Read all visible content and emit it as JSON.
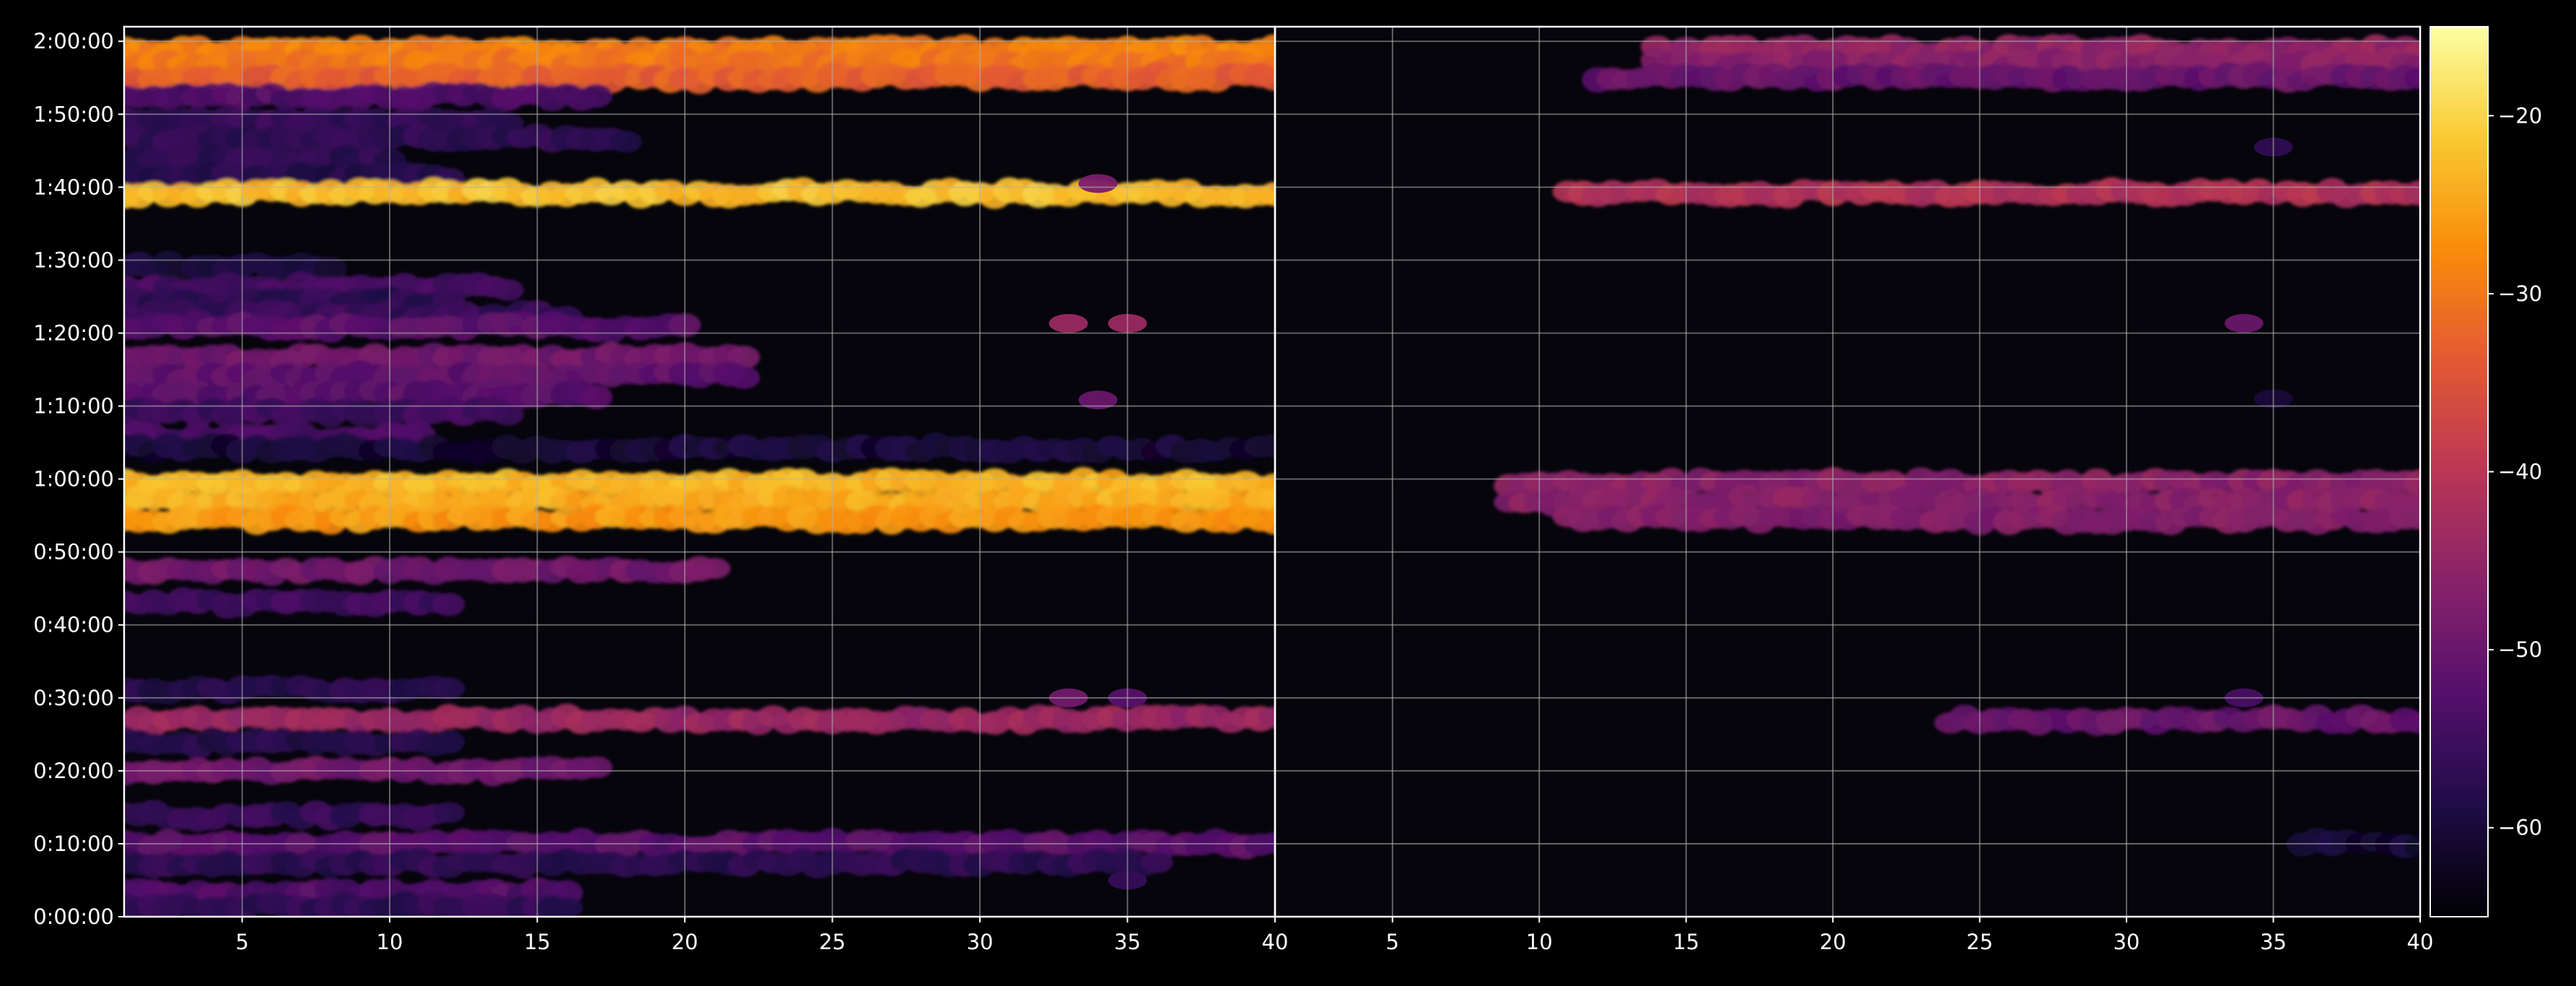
{
  "chart_data": {
    "type": "heatmap",
    "colormap": "inferno",
    "background": "#000000",
    "foreground": "#ffffff",
    "grid": true,
    "title": "",
    "xlabel": "",
    "ylabel": "",
    "y_range_seconds": [
      0,
      7320
    ],
    "y_ticks": [
      {
        "value": 0,
        "label": "0:00:00"
      },
      {
        "value": 600,
        "label": "0:10:00"
      },
      {
        "value": 1200,
        "label": "0:20:00"
      },
      {
        "value": 1800,
        "label": "0:30:00"
      },
      {
        "value": 2400,
        "label": "0:40:00"
      },
      {
        "value": 3000,
        "label": "0:50:00"
      },
      {
        "value": 3600,
        "label": "1:00:00"
      },
      {
        "value": 4200,
        "label": "1:10:00"
      },
      {
        "value": 4800,
        "label": "1:20:00"
      },
      {
        "value": 5400,
        "label": "1:30:00"
      },
      {
        "value": 6000,
        "label": "1:40:00"
      },
      {
        "value": 6600,
        "label": "1:50:00"
      },
      {
        "value": 7200,
        "label": "2:00:00"
      }
    ],
    "panels": [
      {
        "name": "left",
        "x_range": [
          1,
          40
        ],
        "x_ticks": [
          {
            "value": 5,
            "label": "5"
          },
          {
            "value": 10,
            "label": "10"
          },
          {
            "value": 15,
            "label": "15"
          },
          {
            "value": 20,
            "label": "20"
          },
          {
            "value": 25,
            "label": "25"
          },
          {
            "value": 30,
            "label": "30"
          },
          {
            "value": 35,
            "label": "35"
          },
          {
            "value": 40,
            "label": "40"
          }
        ],
        "bands": [
          {
            "y": 7130,
            "x": [
              1,
              40
            ],
            "value": -29
          },
          {
            "y": 7020,
            "x": [
              1,
              40
            ],
            "value": -30
          },
          {
            "y": 6900,
            "x": [
              1,
              40
            ],
            "value": -33
          },
          {
            "y": 6745,
            "x": [
              1,
              17
            ],
            "value": -53
          },
          {
            "y": 6550,
            "x": [
              1,
              14
            ],
            "value": -56
          },
          {
            "y": 6400,
            "x": [
              1,
              18
            ],
            "value": -57
          },
          {
            "y": 6230,
            "x": [
              1,
              10
            ],
            "value": -57
          },
          {
            "y": 6100,
            "x": [
              1,
              12
            ],
            "value": -58
          },
          {
            "y": 5950,
            "x": [
              1,
              40
            ],
            "value": -22
          },
          {
            "y": 5350,
            "x": [
              1,
              8
            ],
            "value": -60
          },
          {
            "y": 5180,
            "x": [
              1,
              14
            ],
            "value": -54
          },
          {
            "y": 5060,
            "x": [
              1,
              12
            ],
            "value": -57
          },
          {
            "y": 4950,
            "x": [
              1,
              16
            ],
            "value": -56
          },
          {
            "y": 4850,
            "x": [
              1,
              20
            ],
            "value": -52
          },
          {
            "y": 4600,
            "x": [
              1,
              22
            ],
            "value": -49
          },
          {
            "y": 4450,
            "x": [
              1,
              22
            ],
            "value": -51
          },
          {
            "y": 4300,
            "x": [
              1,
              17
            ],
            "value": -52
          },
          {
            "y": 4150,
            "x": [
              1,
              14
            ],
            "value": -55
          },
          {
            "y": 3950,
            "x": [
              1,
              11
            ],
            "value": -54
          },
          {
            "y": 3850,
            "x": [
              1,
              40
            ],
            "value": -60
          },
          {
            "y": 3570,
            "x": [
              1,
              40
            ],
            "value": -23
          },
          {
            "y": 3420,
            "x": [
              1,
              40
            ],
            "value": -24
          },
          {
            "y": 3270,
            "x": [
              1,
              40
            ],
            "value": -26
          },
          {
            "y": 2850,
            "x": [
              1,
              21
            ],
            "value": -49
          },
          {
            "y": 2580,
            "x": [
              1,
              12
            ],
            "value": -55
          },
          {
            "y": 1870,
            "x": [
              1,
              12
            ],
            "value": -58
          },
          {
            "y": 1620,
            "x": [
              1,
              40
            ],
            "value": -44
          },
          {
            "y": 1430,
            "x": [
              1,
              12
            ],
            "value": -58
          },
          {
            "y": 1200,
            "x": [
              1,
              17
            ],
            "value": -49
          },
          {
            "y": 830,
            "x": [
              1,
              12
            ],
            "value": -56
          },
          {
            "y": 600,
            "x": [
              1,
              40
            ],
            "value": -52
          },
          {
            "y": 440,
            "x": [
              1,
              36
            ],
            "value": -57
          },
          {
            "y": 200,
            "x": [
              1,
              16
            ],
            "value": -53
          },
          {
            "y": 80,
            "x": [
              1,
              16
            ],
            "value": -57
          }
        ],
        "spots": [
          {
            "x": 34,
            "y": 6030,
            "value": -48
          },
          {
            "x": 33,
            "y": 4880,
            "value": -44
          },
          {
            "x": 35,
            "y": 4880,
            "value": -44
          },
          {
            "x": 34,
            "y": 4250,
            "value": -50
          },
          {
            "x": 33,
            "y": 1800,
            "value": -49
          },
          {
            "x": 35,
            "y": 1800,
            "value": -52
          },
          {
            "x": 35,
            "y": 300,
            "value": -56
          }
        ]
      },
      {
        "name": "right",
        "x_range": [
          1,
          40
        ],
        "x_ticks": [
          {
            "value": 5,
            "label": "5"
          },
          {
            "value": 10,
            "label": "10"
          },
          {
            "value": 15,
            "label": "15"
          },
          {
            "value": 20,
            "label": "20"
          },
          {
            "value": 25,
            "label": "25"
          },
          {
            "value": 30,
            "label": "30"
          },
          {
            "value": 35,
            "label": "35"
          },
          {
            "value": 40,
            "label": "40"
          }
        ],
        "bands": [
          {
            "y": 7130,
            "x": [
              14,
              40
            ],
            "value": -45
          },
          {
            "y": 7020,
            "x": [
              14,
              40
            ],
            "value": -46
          },
          {
            "y": 6900,
            "x": [
              12,
              40
            ],
            "value": -50
          },
          {
            "y": 5950,
            "x": [
              11,
              40
            ],
            "value": -41
          },
          {
            "y": 3570,
            "x": [
              9,
              40
            ],
            "value": -46
          },
          {
            "y": 3420,
            "x": [
              9,
              40
            ],
            "value": -46
          },
          {
            "y": 3270,
            "x": [
              11,
              40
            ],
            "value": -47
          },
          {
            "y": 1620,
            "x": [
              24,
              40
            ],
            "value": -50
          },
          {
            "y": 600,
            "x": [
              36,
              40
            ],
            "value": -60
          }
        ],
        "spots": [
          {
            "x": 34,
            "y": 4880,
            "value": -50
          },
          {
            "x": 34,
            "y": 1800,
            "value": -54
          },
          {
            "x": 35,
            "y": 6330,
            "value": -57
          },
          {
            "x": 35,
            "y": 4260,
            "value": -60
          }
        ]
      }
    ],
    "colorbar": {
      "range": [
        -65,
        -15
      ],
      "ticks": [
        {
          "value": -20,
          "label": "−20"
        },
        {
          "value": -30,
          "label": "−30"
        },
        {
          "value": -40,
          "label": "−40"
        },
        {
          "value": -50,
          "label": "−50"
        },
        {
          "value": -60,
          "label": "−60"
        }
      ]
    }
  }
}
